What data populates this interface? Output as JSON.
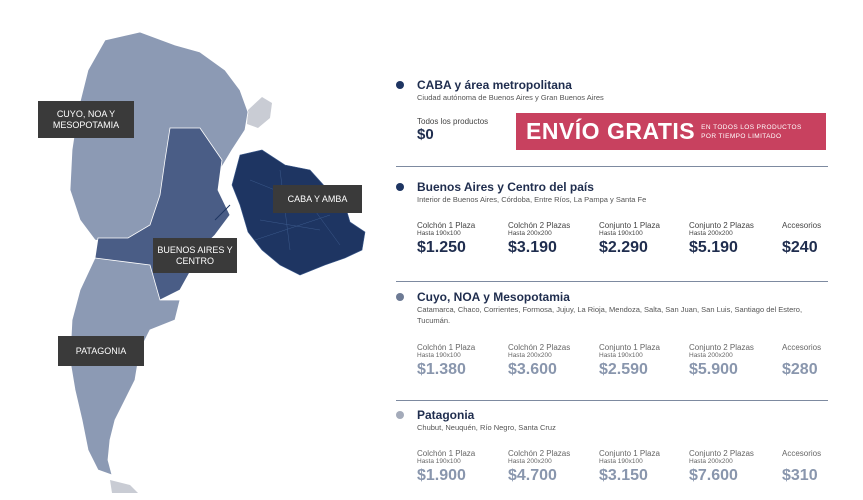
{
  "map": {
    "labels": {
      "cuyo": "CUYO, NOA Y MESOPOTAMIA",
      "caba": "CABA Y AMBA",
      "bsas": "BUENOS AIRES Y CENTRO",
      "patagonia": "PATAGONIA"
    },
    "colors": {
      "light": "#8c9ab4",
      "mid": "#4a5d86",
      "dark": "#1e3562",
      "pale": "#c9ccd4"
    }
  },
  "regions": {
    "caba": {
      "title": "CABA y área metropolitana",
      "subtitle": "Ciudad autónoma de Buenos Aires y Gran Buenos Aires",
      "all_products_label": "Todos los productos",
      "all_products_price": "$0",
      "banner_main": "ENVÍO GRATIS",
      "banner_side_1": "EN TODOS LOS PRODUCTOS",
      "banner_side_2": "POR TIEMPO LIMITADO",
      "bullet_color": "#1e3562"
    },
    "bsas": {
      "title": "Buenos Aires y Centro del país",
      "subtitle": "Interior de Buenos Aires, Córdoba, Entre Ríos, La Pampa y Santa Fe",
      "bullet_color": "#1e3562",
      "prices": [
        {
          "name": "Colchón 1 Plaza",
          "size": "Hasta 190x100",
          "value": "$1.250"
        },
        {
          "name": "Colchón 2 Plazas",
          "size": "Hasta 200x200",
          "value": "$3.190"
        },
        {
          "name": "Conjunto 1 Plaza",
          "size": "Hasta 190x100",
          "value": "$2.290"
        },
        {
          "name": "Conjunto 2 Plazas",
          "size": "Hasta 200x200",
          "value": "$5.190"
        },
        {
          "name": "Accesorios",
          "size": "",
          "value": "$240"
        }
      ]
    },
    "cuyo": {
      "title": "Cuyo, NOA y Mesopotamia",
      "subtitle": "Catamarca, Chaco, Corrientes, Formosa, Jujuy, La Rioja, Mendoza, Salta, San Juan, San Luis, Santiago del Estero, Tucumán.",
      "bullet_color": "#6d7a94",
      "prices": [
        {
          "name": "Colchón 1 Plaza",
          "size": "Hasta 190x100",
          "value": "$1.380"
        },
        {
          "name": "Colchón 2 Plazas",
          "size": "Hasta 200x200",
          "value": "$3.600"
        },
        {
          "name": "Conjunto 1 Plaza",
          "size": "Hasta 190x100",
          "value": "$2.590"
        },
        {
          "name": "Conjunto 2 Plazas",
          "size": "Hasta 200x200",
          "value": "$5.900"
        },
        {
          "name": "Accesorios",
          "size": "",
          "value": "$280"
        }
      ]
    },
    "patagonia": {
      "title": "Patagonia",
      "subtitle": "Chubut, Neuquén, Río Negro, Santa Cruz",
      "bullet_color": "#a4abba",
      "prices": [
        {
          "name": "Colchón 1 Plaza",
          "size": "Hasta 190x100",
          "value": "$1.900"
        },
        {
          "name": "Colchón 2 Plazas",
          "size": "Hasta 200x200",
          "value": "$4.700"
        },
        {
          "name": "Conjunto 1 Plaza",
          "size": "Hasta 190x100",
          "value": "$3.150"
        },
        {
          "name": "Conjunto 2 Plazas",
          "size": "Hasta 200x200",
          "value": "$7.600"
        },
        {
          "name": "Accesorios",
          "size": "",
          "value": "$310"
        }
      ]
    }
  }
}
